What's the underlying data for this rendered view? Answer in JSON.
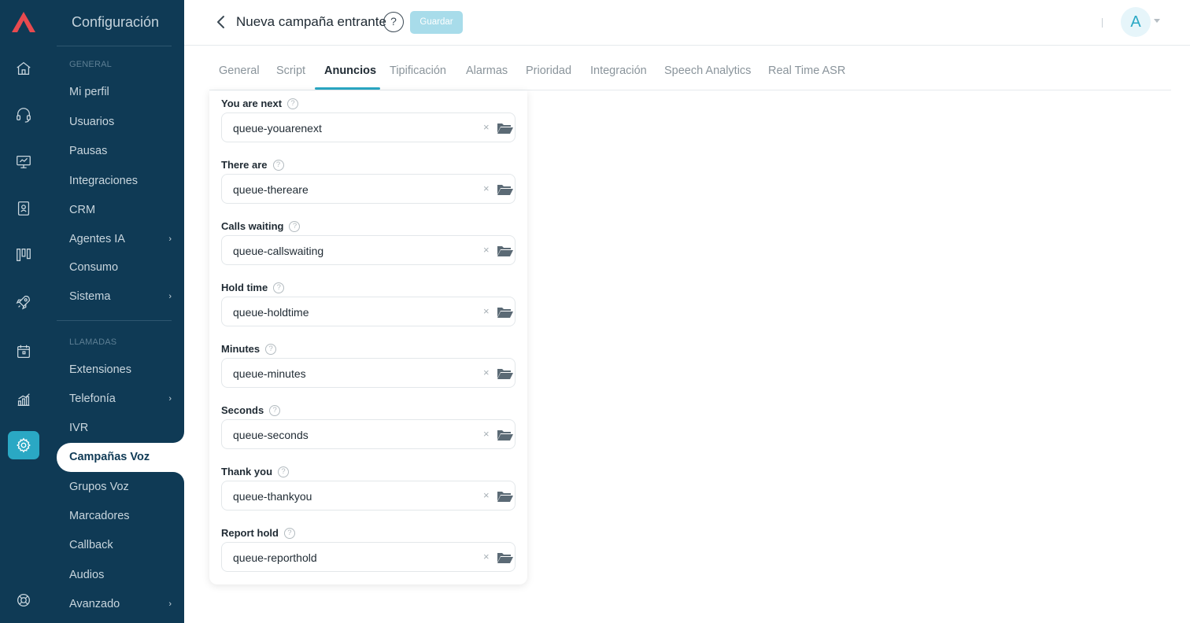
{
  "app": {
    "section_title": "Configuración"
  },
  "rail": {
    "icons": [
      "logo-icon",
      "home-icon",
      "headset-icon",
      "monitor-icon",
      "contacts-book-icon",
      "kanban-icon",
      "rocket-icon",
      "calendar-icon",
      "analytics-icon",
      "settings-icon",
      "support-icon"
    ]
  },
  "sidebar": {
    "section_general": "GENERAL",
    "section_calls": "LLAMADAS",
    "items": [
      {
        "label": "Mi perfil"
      },
      {
        "label": "Usuarios"
      },
      {
        "label": "Pausas"
      },
      {
        "label": "Integraciones"
      },
      {
        "label": "CRM"
      },
      {
        "label": "Agentes IA"
      },
      {
        "label": "Consumo"
      },
      {
        "label": "Sistema"
      },
      {
        "label": "Extensiones"
      },
      {
        "label": "Telefonía"
      },
      {
        "label": "IVR"
      },
      {
        "label": "Campañas Voz"
      },
      {
        "label": "Grupos Voz"
      },
      {
        "label": "Marcadores"
      },
      {
        "label": "Callback"
      },
      {
        "label": "Audios"
      },
      {
        "label": "Avanzado"
      }
    ]
  },
  "header": {
    "title": "Nueva campaña entrante",
    "help": "?",
    "save_label": "Guardar",
    "avatar_initial": "A"
  },
  "tabs": [
    {
      "label": "General"
    },
    {
      "label": "Script"
    },
    {
      "label": "Anuncios"
    },
    {
      "label": "Tipificación"
    },
    {
      "label": "Alarmas"
    },
    {
      "label": "Prioridad"
    },
    {
      "label": "Integración"
    },
    {
      "label": "Speech Analytics"
    },
    {
      "label": "Real Time ASR"
    }
  ],
  "active_tab": "Anuncios",
  "fields": [
    {
      "label": "You are next",
      "value": "queue-youarenext"
    },
    {
      "label": "There are",
      "value": "queue-thereare"
    },
    {
      "label": "Calls waiting",
      "value": "queue-callswaiting"
    },
    {
      "label": "Hold time",
      "value": "queue-holdtime"
    },
    {
      "label": "Minutes",
      "value": "queue-minutes"
    },
    {
      "label": "Seconds",
      "value": "queue-seconds"
    },
    {
      "label": "Thank you",
      "value": "queue-thankyou"
    },
    {
      "label": "Report hold",
      "value": "queue-reporthold"
    }
  ],
  "symbols": {
    "help_glyph": "?",
    "clear_glyph": "×",
    "chevron_glyph": "›"
  },
  "colors": {
    "sidebar_bg": "#0f3a55",
    "accent": "#2aa8c4",
    "save_button_bg": "#a8dcea",
    "logo_red": "#e84a4f"
  }
}
